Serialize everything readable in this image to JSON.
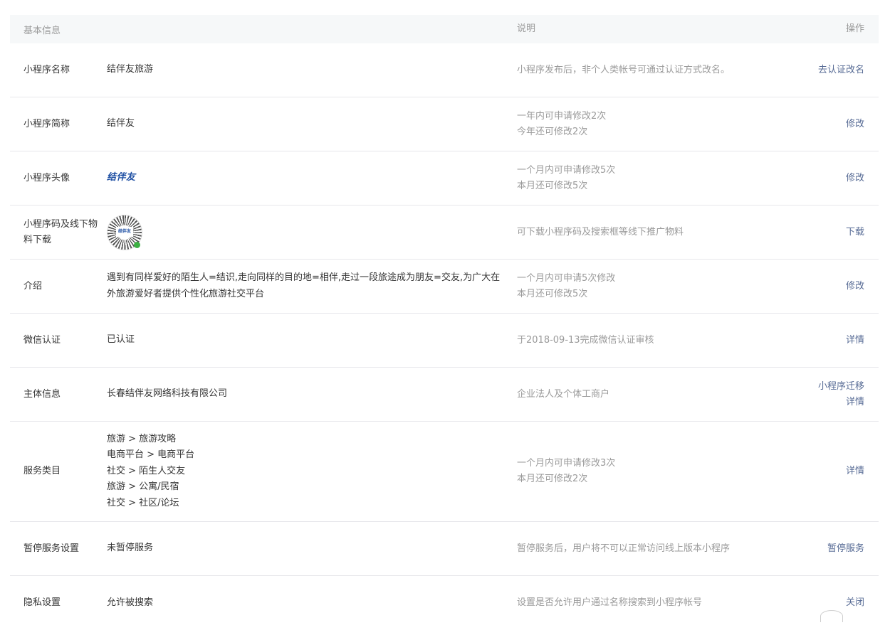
{
  "header": {
    "basic_info": "基本信息",
    "description": "说明",
    "operation": "操作"
  },
  "rows": [
    {
      "label": "小程序名称",
      "value": "结伴友旅游",
      "desc1": "小程序发布后，非个人类帐号可通过认证方式改名。",
      "desc2": "",
      "op1": "去认证改名",
      "op2": ""
    },
    {
      "label": "小程序简称",
      "value": "结伴友",
      "desc1": "一年内可申请修改2次",
      "desc2": "今年还可修改2次",
      "op1": "修改",
      "op2": ""
    },
    {
      "label": "小程序头像",
      "value": "结伴友",
      "desc1": "一个月内可申请修改5次",
      "desc2": "本月还可修改5次",
      "op1": "修改",
      "op2": ""
    },
    {
      "label": "小程序码及线下物料下载",
      "value": "结伴友",
      "desc1": "可下载小程序码及搜索框等线下推广物料",
      "desc2": "",
      "op1": "下载",
      "op2": ""
    },
    {
      "label": "介绍",
      "value": "遇到有同样爱好的陌生人=结识,走向同样的目的地=相伴,走过一段旅途成为朋友=交友,为广大在外旅游爱好者提供个性化旅游社交平台",
      "desc1": "一个月内可申请5次修改",
      "desc2": "本月还可修改5次",
      "op1": "修改",
      "op2": ""
    },
    {
      "label": "微信认证",
      "value": "已认证",
      "desc1": "于2018-09-13完成微信认证审核",
      "desc2": "",
      "op1": "详情",
      "op2": ""
    },
    {
      "label": "主体信息",
      "value": "长春结伴友网络科技有限公司",
      "desc1": "企业法人及个体工商户",
      "desc2": "",
      "op1": "小程序迁移",
      "op2": "详情"
    },
    {
      "label": "服务类目",
      "categories": [
        "旅游 > 旅游攻略",
        "电商平台 > 电商平台",
        "社交 > 陌生人交友",
        "旅游 > 公寓/民宿",
        "社交 > 社区/论坛"
      ],
      "desc1": "一个月内可申请修改3次",
      "desc2": "本月还可修改2次",
      "op1": "详情",
      "op2": ""
    },
    {
      "label": "暂停服务设置",
      "value": "未暂停服务",
      "desc1": "暂停服务后，用户将不可以正常访问线上版本小程序",
      "desc2": "",
      "op1": "暂停服务",
      "op2": ""
    },
    {
      "label": "隐私设置",
      "value": "允许被搜索",
      "desc1": "设置是否允许用户通过名称搜索到小程序帐号",
      "desc2": "",
      "op1": "关闭",
      "op2": ""
    }
  ],
  "colors": {
    "link": "#576b95",
    "muted": "#9a9a9a",
    "header_bg": "#f6f8f9",
    "border": "#e7e7eb"
  }
}
